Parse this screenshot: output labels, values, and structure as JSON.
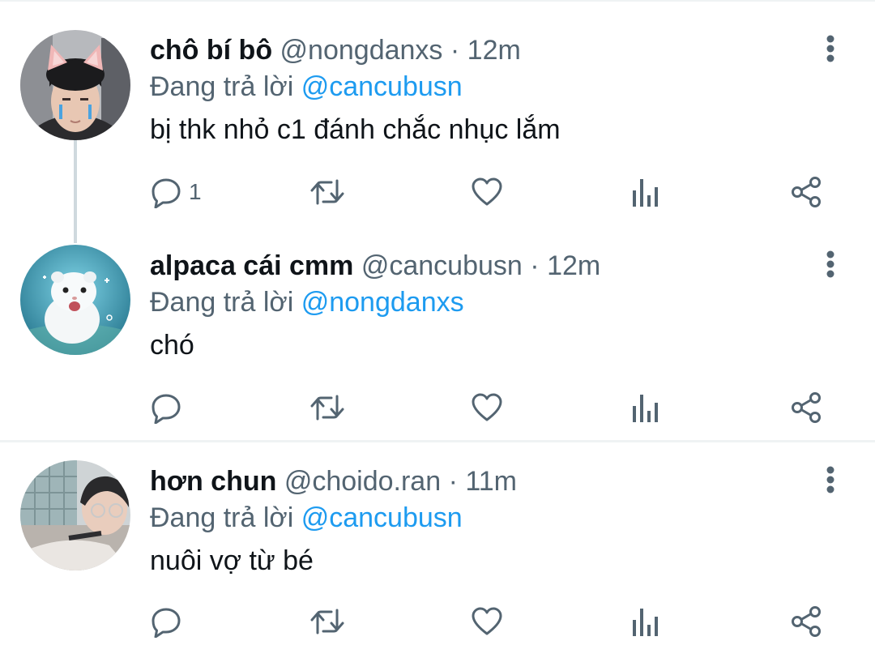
{
  "tweets": [
    {
      "display_name": "chô bí bô",
      "handle": "@nongdanxs",
      "separator": "·",
      "time": "12m",
      "reply_prefix": "Đang trả lời",
      "reply_to": "@cancubusn",
      "text": "bị thk nhỏ c1 đánh chắc nhục lắm",
      "reply_count": "1",
      "avatar_icon": "avatar-photo-cat-ears"
    },
    {
      "display_name": "alpaca cái cmm",
      "handle": "@cancubusn",
      "separator": "·",
      "time": "12m",
      "reply_prefix": "Đang trả lời",
      "reply_to": "@nongdanxs",
      "text": "chó",
      "reply_count": "",
      "avatar_icon": "avatar-photo-white-ferret"
    },
    {
      "display_name": "hơn chun",
      "handle": "@choido.ran",
      "separator": "·",
      "time": "11m",
      "reply_prefix": "Đang trả lời",
      "reply_to": "@cancubusn",
      "text": "nuôi vợ từ bé",
      "reply_count": "",
      "avatar_icon": "avatar-photo-person-glasses"
    }
  ],
  "icons": {
    "reply": "reply-icon",
    "retweet": "retweet-icon",
    "like": "heart-icon",
    "views": "views-icon",
    "share": "share-icon",
    "more": "more-vertical-icon"
  },
  "colors": {
    "text_primary": "#0f1419",
    "text_secondary": "#536471",
    "mention": "#1d9bf0",
    "divider": "#eff3f4",
    "thread_line": "#cfd9de"
  }
}
